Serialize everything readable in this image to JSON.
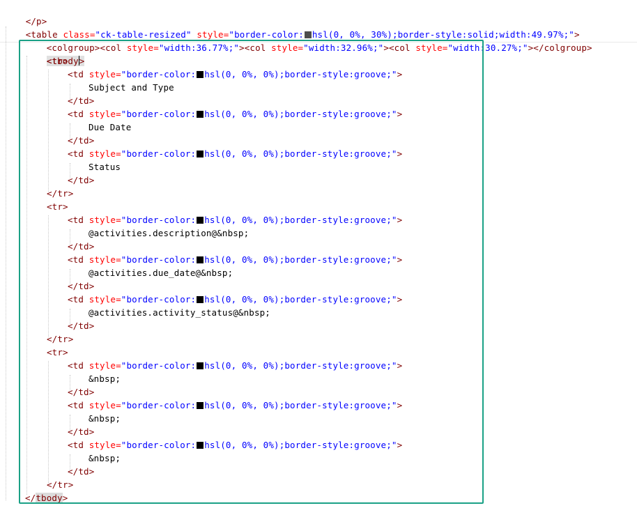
{
  "lines": [
    "</p>",
    "<table class=\"ck-table-resized\" style=\"border-color:",
    "hsl(0, 0%, 30%);border-style:solid;width:49.97%;\">",
    "<colgroup><col style=\"width:36.77%;\"><col style=\"width:32.96%;\"><col style=\"width:30.27%;\"></colgroup>",
    "<tbody>"
  ],
  "code": {
    "p_close": "</p>",
    "table_open": "<table",
    "class_attr": " class=",
    "class_val": "\"ck-table-resized\"",
    "style_attr": " style=",
    "style_val_a": "\"border-color:",
    "table_style_rest": "hsl(0, 0%, 30%);border-style:solid;width:49.97%;\"",
    "gt": ">",
    "colgroup_open": "<colgroup>",
    "col_open": "<col",
    "col1_val": "\"width:36.77%;\"",
    "col2_val": "\"width:32.96%;\"",
    "col3_val": "\"width:30.27%;\"",
    "colgroup_close": "</colgroup>",
    "tbody_lt": "<",
    "tbody_name": "tbody",
    "tbody_gt": ">",
    "tbody_close_lt": "</",
    "tr_open": "<tr>",
    "tr_close": "</tr>",
    "td_open": "<td",
    "td_style_rest": "hsl(0, 0%, 0%);border-style:groove;\"",
    "td_close": "</td>",
    "cell_subject": "Subject and Type",
    "cell_due": "Due Date",
    "cell_status": "Status",
    "cell_desc": "@activities.description@&nbsp;",
    "cell_due_date": "@activities.due_date@&nbsp;",
    "cell_activity_status": "@activities.activity_status@&nbsp;",
    "nbsp": "&nbsp;"
  },
  "colors": {
    "tag": "#800000",
    "attribute": "#ff0000",
    "value": "#0000ff",
    "selection_border": "#1aa186",
    "swatch_table_border": "#4d4d4d",
    "swatch_td_border": "#000000"
  }
}
